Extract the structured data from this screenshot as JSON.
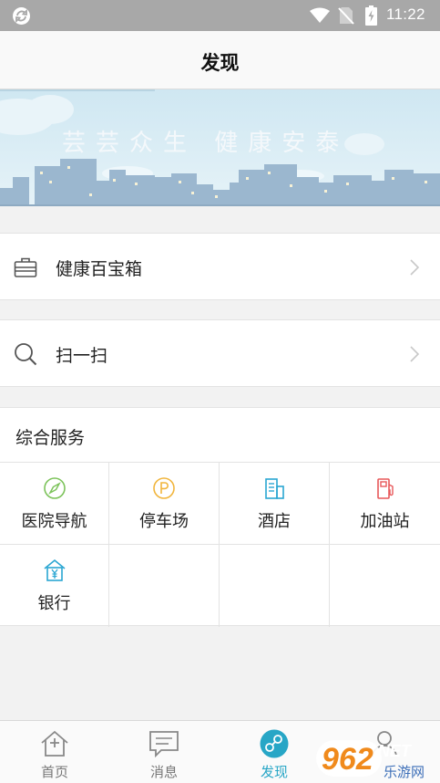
{
  "status_bar": {
    "time": "11:22",
    "icons": [
      "sync-icon",
      "wifi-icon",
      "no-sim-icon",
      "battery-charging-icon"
    ]
  },
  "header": {
    "title": "发现"
  },
  "banner": {
    "slogan": "芸芸众生 健康安泰"
  },
  "menu": [
    {
      "label": "健康百宝箱",
      "icon": "briefcase-icon"
    },
    {
      "label": "扫一扫",
      "icon": "search-icon"
    }
  ],
  "services": {
    "title": "综合服务",
    "items": [
      {
        "label": "医院导航",
        "icon": "compass-icon",
        "color": "#7cc35a"
      },
      {
        "label": "停车场",
        "icon": "parking-icon",
        "color": "#f1b53c"
      },
      {
        "label": "酒店",
        "icon": "hotel-icon",
        "color": "#2aa6d2"
      },
      {
        "label": "加油站",
        "icon": "gas-station-icon",
        "color": "#e8585a"
      },
      {
        "label": "银行",
        "icon": "bank-icon",
        "color": "#2aa6d2"
      }
    ]
  },
  "tabbar": {
    "tabs": [
      {
        "label": "首页",
        "icon": "home-icon",
        "active": false
      },
      {
        "label": "消息",
        "icon": "message-icon",
        "active": false
      },
      {
        "label": "发现",
        "icon": "discover-icon",
        "active": true
      },
      {
        "label": "",
        "icon": "profile-icon",
        "active": false
      }
    ]
  },
  "watermark": {
    "text": "962.NET",
    "subtext": "乐游网"
  },
  "colors": {
    "accent": "#27a6c6",
    "status_bar": "#a8a8a8",
    "background": "#f2f2f2"
  }
}
